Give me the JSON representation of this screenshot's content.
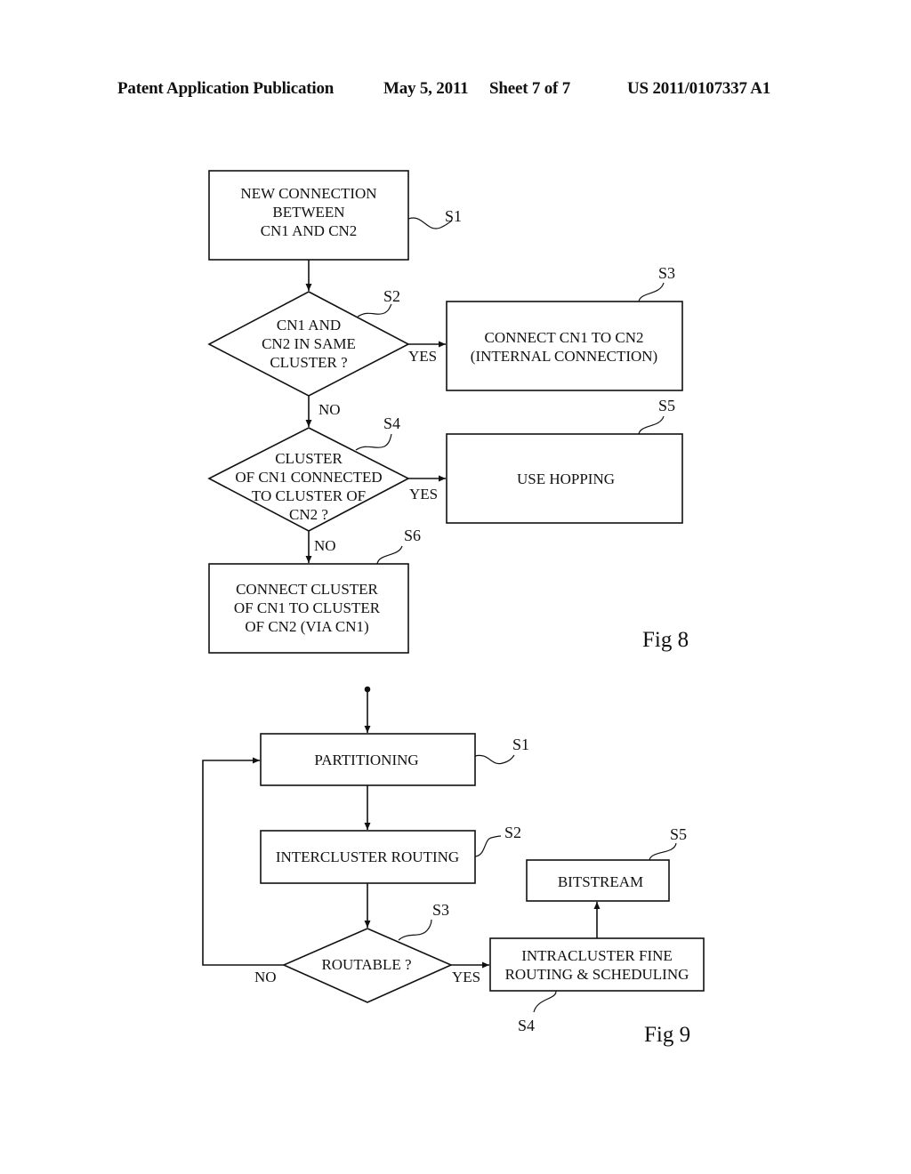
{
  "header": {
    "publication": "Patent Application Publication",
    "date": "May 5, 2011",
    "sheet": "Sheet 7 of 7",
    "number": "US 2011/0107337 A1"
  },
  "fig8": {
    "caption": "Fig 8",
    "s1": {
      "ref": "S1",
      "lines": [
        "NEW CONNECTION",
        "BETWEEN",
        "CN1 AND CN2"
      ]
    },
    "s2": {
      "ref": "S2",
      "lines": [
        "CN1 AND",
        "CN2 IN SAME",
        "CLUSTER ?"
      ]
    },
    "s3": {
      "ref": "S3",
      "lines": [
        "CONNECT CN1 TO CN2",
        "(INTERNAL CONNECTION)"
      ]
    },
    "s4": {
      "ref": "S4",
      "lines": [
        "CLUSTER",
        "OF CN1 CONNECTED",
        "TO CLUSTER OF",
        "CN2 ?"
      ]
    },
    "s5": {
      "ref": "S5",
      "lines": [
        "USE HOPPING"
      ]
    },
    "s6": {
      "ref": "S6",
      "lines": [
        "CONNECT CLUSTER",
        "OF CN1 TO CLUSTER",
        "OF CN2 (VIA CN1)"
      ]
    },
    "yes": "YES",
    "no": "NO"
  },
  "fig9": {
    "caption": "Fig 9",
    "s1": {
      "ref": "S1",
      "lines": [
        "PARTITIONING"
      ]
    },
    "s2": {
      "ref": "S2",
      "lines": [
        "INTERCLUSTER ROUTING"
      ]
    },
    "s3": {
      "ref": "S3",
      "lines": [
        "ROUTABLE ?"
      ]
    },
    "s4": {
      "ref": "S4",
      "lines": [
        "INTRACLUSTER FINE",
        "ROUTING & SCHEDULING"
      ]
    },
    "s5": {
      "ref": "S5",
      "lines": [
        "BITSTREAM"
      ]
    },
    "yes": "YES",
    "no": "NO"
  }
}
